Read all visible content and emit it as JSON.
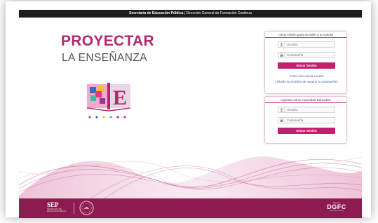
{
  "topbar": {
    "org_bold": "Secretaría de Educación Pública",
    "separator": " | ",
    "org_rest": "Dirección General de Formación Continua"
  },
  "logo": {
    "title": "PROYECTAR",
    "subtitle": "LA ENSEÑANZA",
    "book_letter": "E"
  },
  "login_box": {
    "heading": "Inicia sesión para acceder a tu cuenta",
    "user_placeholder": "Usuario",
    "password_placeholder": "Contraseña",
    "submit_label": "Iniciar Sesión",
    "create_account_link": "Crear una nueva cuenta",
    "forgot_link": "¿Olvidó su nombre de usuario o contraseña?"
  },
  "authority_box": {
    "heading": "Ingresar como Autoridad Educativa",
    "user_placeholder": "Usuario",
    "password_placeholder": "Contraseña",
    "submit_label": "Iniciar Sesión"
  },
  "footer": {
    "sep_label": "SEP",
    "sep_sub": "SECRETARÍA DE EDUCACIÓN PÚBLICA",
    "dgfc_label": "DGFC",
    "dgfc_top": "Dirección",
    "dgfc_bottom": "Formación Continua"
  },
  "colors": {
    "brand": "#b3276d",
    "button": "#c2206f",
    "footer": "#8c1c50",
    "link": "#3a5fa8"
  }
}
